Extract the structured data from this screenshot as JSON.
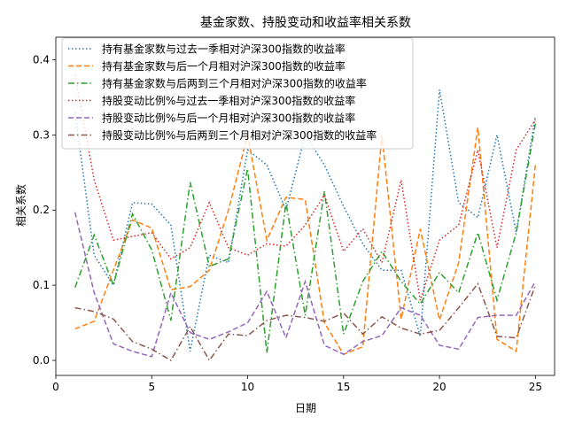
{
  "chart_data": {
    "type": "line",
    "title": "基金家数、持股变动和收益率相关系数",
    "xlabel": "日期",
    "ylabel": "相关系数",
    "xlim": [
      0,
      26
    ],
    "ylim": [
      -0.02,
      0.43
    ],
    "xticks": [
      0,
      5,
      10,
      15,
      20,
      25
    ],
    "xtick_labels": [
      "0",
      "5",
      "10",
      "15",
      "20",
      "25"
    ],
    "yticks": [
      0.0,
      0.1,
      0.2,
      0.3,
      0.4
    ],
    "ytick_labels": [
      "0.0",
      "0.1",
      "0.2",
      "0.3",
      "0.4"
    ],
    "grid": false,
    "legend_position": "top-left",
    "x": [
      1,
      2,
      3,
      4,
      5,
      6,
      7,
      8,
      9,
      10,
      11,
      12,
      13,
      14,
      15,
      16,
      17,
      18,
      19,
      20,
      21,
      22,
      23,
      24,
      25
    ],
    "series": [
      {
        "name": "持有基金家数与过去一季相对沪深300指数的收益率",
        "color": "#1f77b4",
        "dash": "dotted",
        "values": [
          0.33,
          0.14,
          0.1,
          0.21,
          0.208,
          0.18,
          0.012,
          0.14,
          0.13,
          0.28,
          0.26,
          0.2,
          0.3,
          0.26,
          0.205,
          0.155,
          0.12,
          0.12,
          0.032,
          0.36,
          0.21,
          0.19,
          0.3,
          0.17,
          0.325
        ]
      },
      {
        "name": "持有基金家数与后一个月相对沪深300指数的收益率",
        "color": "#ff7f0e",
        "dash": "dashed",
        "values": [
          0.042,
          0.052,
          0.12,
          0.187,
          0.176,
          0.094,
          0.098,
          0.12,
          0.2,
          0.3,
          0.16,
          0.217,
          0.214,
          0.05,
          0.008,
          0.018,
          0.3,
          0.055,
          0.175,
          0.054,
          0.13,
          0.31,
          0.028,
          0.012,
          0.26
        ]
      },
      {
        "name": "持有基金家数与后两到三个月相对沪深300指数的收益率",
        "color": "#2ca02c",
        "dash": "dashdot",
        "values": [
          0.097,
          0.167,
          0.1,
          0.195,
          0.147,
          0.053,
          0.237,
          0.125,
          0.135,
          0.255,
          0.01,
          0.21,
          0.06,
          0.225,
          0.035,
          0.105,
          0.145,
          0.105,
          0.075,
          0.117,
          0.09,
          0.17,
          0.08,
          0.17,
          0.315
        ]
      },
      {
        "name": "持股变动比例%与过去一季相对沪深300指数的收益率",
        "color": "#d62728",
        "dash": "dotted",
        "values": [
          0.38,
          0.24,
          0.16,
          0.165,
          0.17,
          0.135,
          0.15,
          0.21,
          0.15,
          0.14,
          0.155,
          0.152,
          0.18,
          0.22,
          0.145,
          0.175,
          0.13,
          0.24,
          0.08,
          0.16,
          0.18,
          0.28,
          0.15,
          0.28,
          0.32
        ]
      },
      {
        "name": "持股变动比例%与后一个月相对沪深300指数的收益率",
        "color": "#9467bd",
        "dash": "dashed",
        "values": [
          0.197,
          0.09,
          0.022,
          0.012,
          0.005,
          0.09,
          0.037,
          0.028,
          0.038,
          0.05,
          0.092,
          0.03,
          0.105,
          0.02,
          0.008,
          0.025,
          0.033,
          0.07,
          0.06,
          0.02,
          0.015,
          0.057,
          0.06,
          0.06,
          0.105
        ]
      },
      {
        "name": "持股变动比例%与后两到三个月相对沪深300指数的收益率",
        "color": "#8c564b",
        "dash": "dashdot",
        "values": [
          0.07,
          0.065,
          0.055,
          0.025,
          0.015,
          0.0,
          0.045,
          0.0,
          0.035,
          0.033,
          0.053,
          0.06,
          0.057,
          0.052,
          0.063,
          0.035,
          0.058,
          0.043,
          0.035,
          0.04,
          0.07,
          0.102,
          0.032,
          0.03,
          0.1
        ]
      }
    ]
  }
}
